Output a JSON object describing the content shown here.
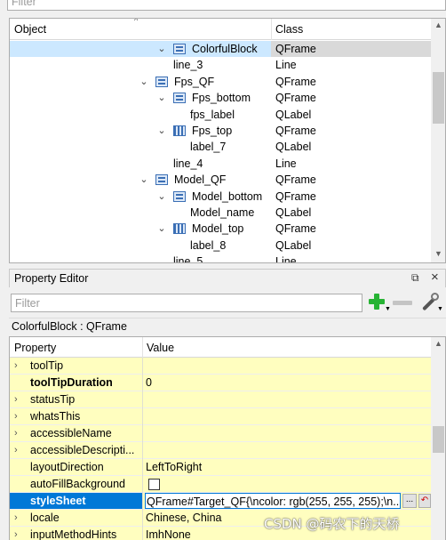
{
  "object_inspector": {
    "filter_placeholder": "Filter",
    "columns": {
      "object": "Object",
      "class": "Class"
    },
    "rows": [
      {
        "name": "ColorfulBlock",
        "class": "QFrame",
        "depth": 3,
        "expanded": true,
        "icon": "vbox-layout-icon",
        "selected": true
      },
      {
        "name": "line_3",
        "class": "Line",
        "depth": 3,
        "expanded": null,
        "icon": null
      },
      {
        "name": "Fps_QF",
        "class": "QFrame",
        "depth": 2,
        "expanded": true,
        "icon": "vbox-layout-icon"
      },
      {
        "name": "Fps_bottom",
        "class": "QFrame",
        "depth": 3,
        "expanded": true,
        "icon": "vbox-layout-icon"
      },
      {
        "name": "fps_label",
        "class": "QLabel",
        "depth": 4,
        "expanded": null,
        "icon": null
      },
      {
        "name": "Fps_top",
        "class": "QFrame",
        "depth": 3,
        "expanded": true,
        "icon": "hbox-layout-icon"
      },
      {
        "name": "label_7",
        "class": "QLabel",
        "depth": 4,
        "expanded": null,
        "icon": null
      },
      {
        "name": "line_4",
        "class": "Line",
        "depth": 2,
        "expanded": null,
        "icon": null
      },
      {
        "name": "Model_QF",
        "class": "QFrame",
        "depth": 2,
        "expanded": true,
        "icon": "vbox-layout-icon"
      },
      {
        "name": "Model_bottom",
        "class": "QFrame",
        "depth": 3,
        "expanded": true,
        "icon": "vbox-layout-icon"
      },
      {
        "name": "Model_name",
        "class": "QLabel",
        "depth": 4,
        "expanded": null,
        "icon": null
      },
      {
        "name": "Model_top",
        "class": "QFrame",
        "depth": 3,
        "expanded": true,
        "icon": "hbox-layout-icon"
      },
      {
        "name": "label_8",
        "class": "QLabel",
        "depth": 4,
        "expanded": null,
        "icon": null
      },
      {
        "name": "line_5",
        "class": "Line",
        "depth": 2,
        "expanded": null,
        "icon": null
      }
    ]
  },
  "property_editor": {
    "title": "Property Editor",
    "filter_placeholder": "Filter",
    "object_class": "ColorfulBlock : QFrame",
    "columns": {
      "property": "Property",
      "value": "Value"
    },
    "rows": [
      {
        "name": "toolTip",
        "value": "",
        "expandable": true,
        "bold": false
      },
      {
        "name": "toolTipDuration",
        "value": "0",
        "expandable": false,
        "bold": true
      },
      {
        "name": "statusTip",
        "value": "",
        "expandable": true,
        "bold": false
      },
      {
        "name": "whatsThis",
        "value": "",
        "expandable": true,
        "bold": false
      },
      {
        "name": "accessibleName",
        "value": "",
        "expandable": true,
        "bold": false
      },
      {
        "name": "accessibleDescripti...",
        "value": "",
        "expandable": true,
        "bold": false
      },
      {
        "name": "layoutDirection",
        "value": "LeftToRight",
        "expandable": false,
        "bold": false
      },
      {
        "name": "autoFillBackground",
        "value": "",
        "expandable": false,
        "bold": false,
        "checkbox": true,
        "checked": false
      },
      {
        "name": "styleSheet",
        "value": "QFrame#Target_QF{\\ncolor: rgb(255, 255, 255);\\n...",
        "expandable": false,
        "bold": true,
        "selected": true,
        "editor": true
      },
      {
        "name": "locale",
        "value": "Chinese, China",
        "expandable": true,
        "bold": false
      },
      {
        "name": "inputMethodHints",
        "value": "ImhNone",
        "expandable": true,
        "bold": false
      }
    ],
    "editor_dots": "...",
    "editor_reset": "↶"
  },
  "watermark": "CSDN @码农下的天桥",
  "colors": {
    "selection": "#0078d7",
    "tree_selection": "#cce8ff",
    "property_row_bg": "#fffebf",
    "add_button": "#27b334"
  }
}
